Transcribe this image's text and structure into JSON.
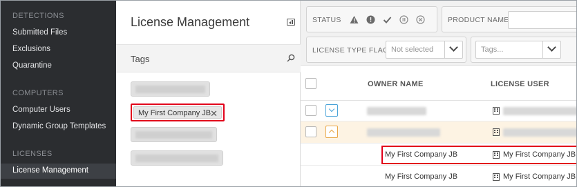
{
  "sidebar": {
    "sections": [
      {
        "title": "DETECTIONS",
        "items": [
          "Submitted Files",
          "Exclusions",
          "Quarantine"
        ]
      },
      {
        "title": "COMPUTERS",
        "items": [
          "Computer Users",
          "Dynamic Group Templates"
        ]
      },
      {
        "title": "LICENSES",
        "items": [
          "License Management"
        ]
      }
    ],
    "active_item": "License Management"
  },
  "tags_panel": {
    "title": "License Management",
    "tags_label": "Tags",
    "named_tag": "My First Company JB",
    "named_tag_remove": "✕"
  },
  "filters": {
    "status_label": "STATUS",
    "status_icons": [
      "warning-icon",
      "error-icon",
      "check-icon",
      "pause-icon",
      "cancel-icon"
    ],
    "product_name_label": "PRODUCT NAME",
    "license_type_flags_label": "LICENSE TYPE FLAGS",
    "license_type_flags_value": "Not selected",
    "tags_placeholder": "Tags..."
  },
  "table": {
    "columns": [
      "OWNER NAME",
      "LICENSE USER"
    ],
    "rows": [
      {
        "owner": "",
        "user": "",
        "expander": "down",
        "highlight": false
      },
      {
        "owner": "",
        "user": "",
        "expander": "up",
        "highlight": true
      },
      {
        "owner": "My First Company JB",
        "user": "My First Company JB",
        "expander": "",
        "highlight": false
      },
      {
        "owner": "My First Company JB",
        "user": "My First Company JB",
        "expander": "",
        "highlight": false
      }
    ]
  },
  "colors": {
    "sidebar_bg": "#2b2d30",
    "highlight_row": "#fdf3e3",
    "annotation_red": "#e2001a",
    "expander_blue": "#4aa3d8",
    "expander_orange": "#e8a544"
  }
}
